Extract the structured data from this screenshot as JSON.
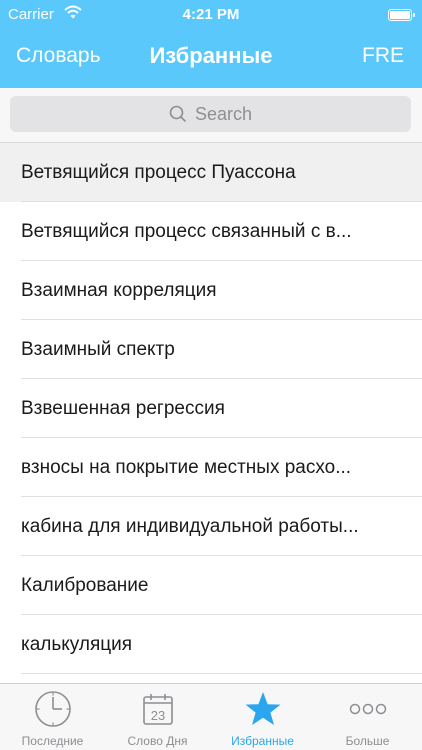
{
  "status_bar": {
    "carrier": "Carrier",
    "time": "4:21 PM"
  },
  "nav": {
    "left": "Словарь",
    "title": "Избранные",
    "right": "FRE"
  },
  "search": {
    "placeholder": "Search"
  },
  "list": {
    "items": [
      "Ветвящийся процесс Пуассона",
      "Ветвящийся процесс связанный с в...",
      "Взаимная корреляция",
      "Взаимный спектр",
      "Взвешенная регрессия",
      "взносы на покрытие местных расхо...",
      "кабина для индивидуальной работы...",
      "Калибрование",
      "калькуляция"
    ]
  },
  "tabs": [
    {
      "label": "Последние",
      "icon": "clock-icon"
    },
    {
      "label": "Слово Дня",
      "icon": "calendar-icon",
      "day": "23"
    },
    {
      "label": "Избранные",
      "icon": "star-icon"
    },
    {
      "label": "Больше",
      "icon": "more-icon"
    }
  ],
  "colors": {
    "accent": "#5ac8fa",
    "tab_active": "#2ba6ee",
    "tab_inactive": "#8e8e93"
  }
}
